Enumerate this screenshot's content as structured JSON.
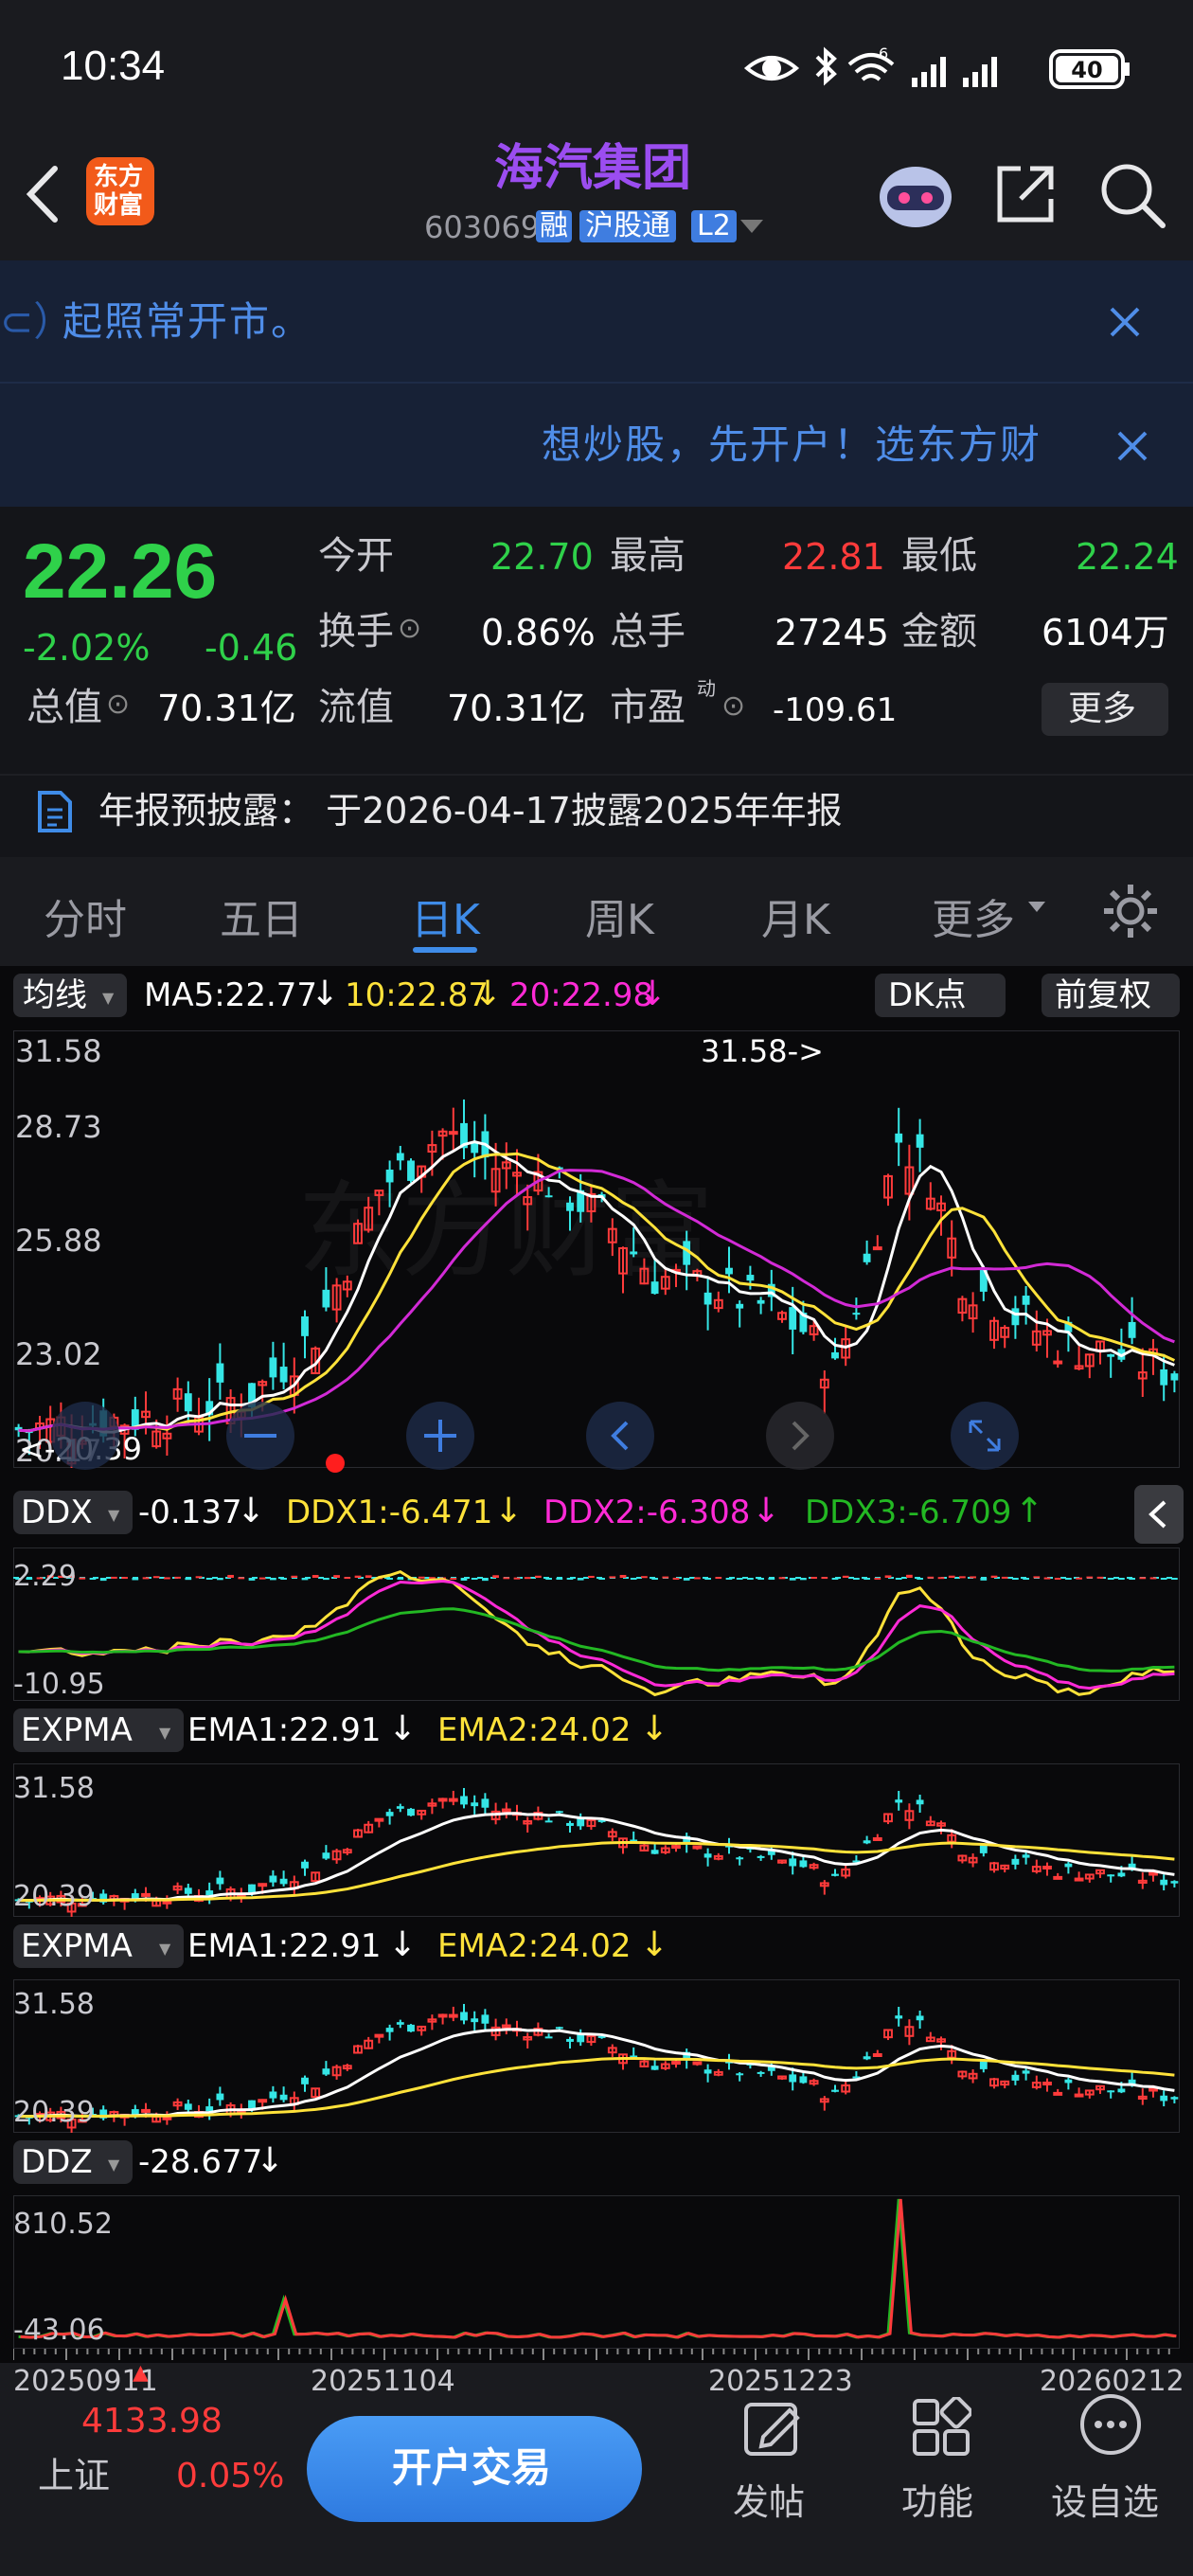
{
  "status": {
    "time": "10:34",
    "battery": "40",
    "net_super": "6"
  },
  "header": {
    "title": "海汽集团",
    "code": "603069",
    "badge_rong": "融",
    "badge_hgt": "沪股通",
    "badge_l2": "L2",
    "logo_line1": "东方",
    "logo_line2": "财富"
  },
  "notices": {
    "line1": "起照常开市。",
    "line1_prefix": "⊂）",
    "line2": "想炒股，先开户！选东方财"
  },
  "quote": {
    "price": "22.26",
    "change_pct": "-2.02%",
    "change": "-0.46",
    "open_label": "今开",
    "open": "22.70",
    "high_label": "最高",
    "high": "22.81",
    "low_label": "最低",
    "low": "22.24",
    "turnover_label": "换手",
    "turnover": "0.86%",
    "volume_label": "总手",
    "volume": "27245",
    "amount_label": "金额",
    "amount": "6104万",
    "mktcap_label": "总值",
    "mktcap": "70.31亿",
    "float_label": "流值",
    "float": "70.31亿",
    "pe_label": "市盈",
    "pe_sup": "动",
    "pe": "-109.61",
    "more_button": "更多",
    "disclosure": "年报预披露：  于2026-04-17披露2025年年报"
  },
  "tabs": [
    "分时",
    "五日",
    "日K",
    "周K",
    "月K",
    "更多"
  ],
  "active_tab": "日K",
  "indicators": {
    "ma_button": "均线",
    "ma5": "MA5:22.77",
    "ma10": "10:22.87",
    "ma20": "20:22.98",
    "dk_button": "DK点",
    "adjust_button": "前复权",
    "k_max": "31.58",
    "k_y2": "28.73",
    "k_y3": "25.88",
    "k_y4": "23.02",
    "k_min": "20.17",
    "k_peak_label": "31.58->",
    "k_low_label": "<-20.39",
    "ddx_button": "DDX",
    "ddx": "-0.137",
    "ddx1": "DDX1:-6.471",
    "ddx2": "DDX2:-6.308",
    "ddx3": "DDX3:-6.709",
    "ddx_max": "2.29",
    "ddx_min": "-10.95",
    "expma_button": "EXPMA",
    "ema1": "EMA1:22.91",
    "ema2": "EMA2:24.02",
    "ema_max": "31.58",
    "ema_min": "20.39",
    "ddz_button": "DDZ",
    "ddz": "-28.677",
    "ddz_max": "810.52",
    "ddz_min": "-43.06"
  },
  "dates": [
    "20250911",
    "20251104",
    "20251223",
    "20260212"
  ],
  "bottom": {
    "index_value": "4133.98",
    "index_name": "上证",
    "index_pct": "0.05%",
    "trade_button": "开户交易",
    "post_label": "发帖",
    "func_label": "功能",
    "watch_label": "设自选"
  },
  "colors": {
    "up": "#ff3b3b",
    "down": "#35e6e6",
    "accent": "#3f8ce8",
    "title": "#9b4df0"
  }
}
